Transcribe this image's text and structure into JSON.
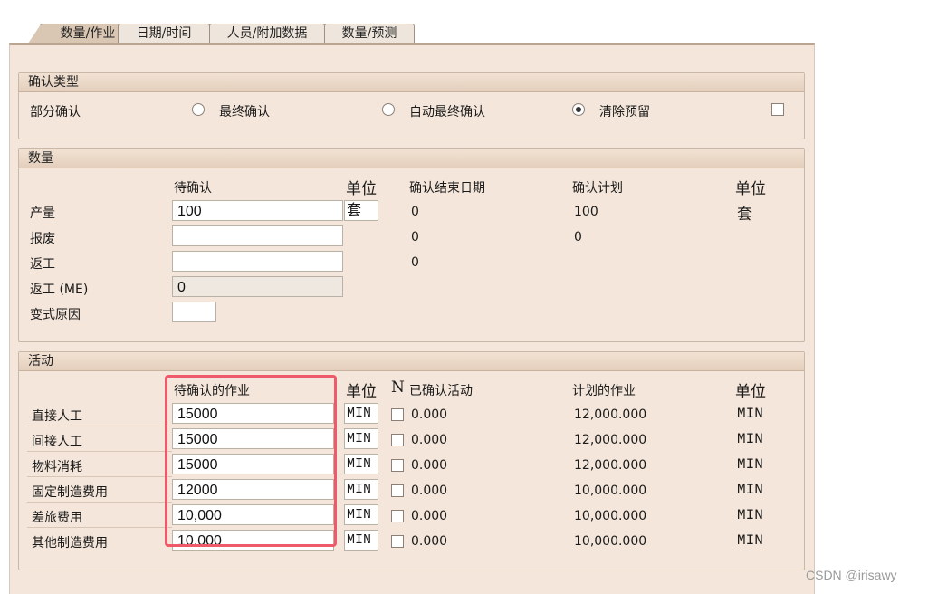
{
  "tabs": [
    {
      "label": "数量/作业",
      "active": true
    },
    {
      "label": "日期/时间",
      "active": false
    },
    {
      "label": "人员/附加数据",
      "active": false
    },
    {
      "label": "数量/预测",
      "active": false
    }
  ],
  "confirm_type": {
    "title": "确认类型",
    "partial": "部分确认",
    "final": "最终确认",
    "auto_final": "自动最终确认",
    "clear_reservation": "清除预留",
    "selected": "clear_reservation"
  },
  "quantity": {
    "title": "数量",
    "col_to_confirm": "待确认",
    "col_unit": "单位",
    "col_confirmed_end": "确认结束日期",
    "col_planned": "确认计划",
    "col_unit2": "单位",
    "rows": [
      {
        "label": "产量",
        "value": "100",
        "unit": "套",
        "confirmed": "0",
        "planned": "100",
        "unit2": "套"
      },
      {
        "label": "报废",
        "value": "",
        "confirmed": "0",
        "planned": "0"
      },
      {
        "label": "返工",
        "value": "",
        "confirmed": "0"
      },
      {
        "label": "返工 (ME)",
        "value": "0"
      },
      {
        "label": "变式原因",
        "value": ""
      }
    ]
  },
  "activities": {
    "title": "活动",
    "col_to_confirm": "待确认的作业",
    "col_unit": "单位",
    "col_n": "N",
    "col_confirmed": "已确认活动",
    "col_planned": "计划的作业",
    "col_unit2": "单位",
    "rows": [
      {
        "label": "直接人工",
        "value": "15000",
        "unit": "MIN",
        "confirmed": "0.000",
        "planned": "12,000.000",
        "unit2": "MIN"
      },
      {
        "label": "间接人工",
        "value": "15000",
        "unit": "MIN",
        "confirmed": "0.000",
        "planned": "12,000.000",
        "unit2": "MIN"
      },
      {
        "label": "物料消耗",
        "value": "15000",
        "unit": "MIN",
        "confirmed": "0.000",
        "planned": "12,000.000",
        "unit2": "MIN"
      },
      {
        "label": "固定制造费用",
        "value": "12000",
        "unit": "MIN",
        "confirmed": "0.000",
        "planned": "10,000.000",
        "unit2": "MIN"
      },
      {
        "label": "差旅费用",
        "value": "10,000",
        "unit": "MIN",
        "confirmed": "0.000",
        "planned": "10,000.000",
        "unit2": "MIN"
      },
      {
        "label": "其他制造费用",
        "value": "10,000",
        "unit": "MIN",
        "confirmed": "0.000",
        "planned": "10,000.000",
        "unit2": "MIN"
      }
    ]
  },
  "watermark": "CSDN @irisawy",
  "colors": {
    "panel": "#f4e6da",
    "highlight": "#ee5a6a"
  }
}
